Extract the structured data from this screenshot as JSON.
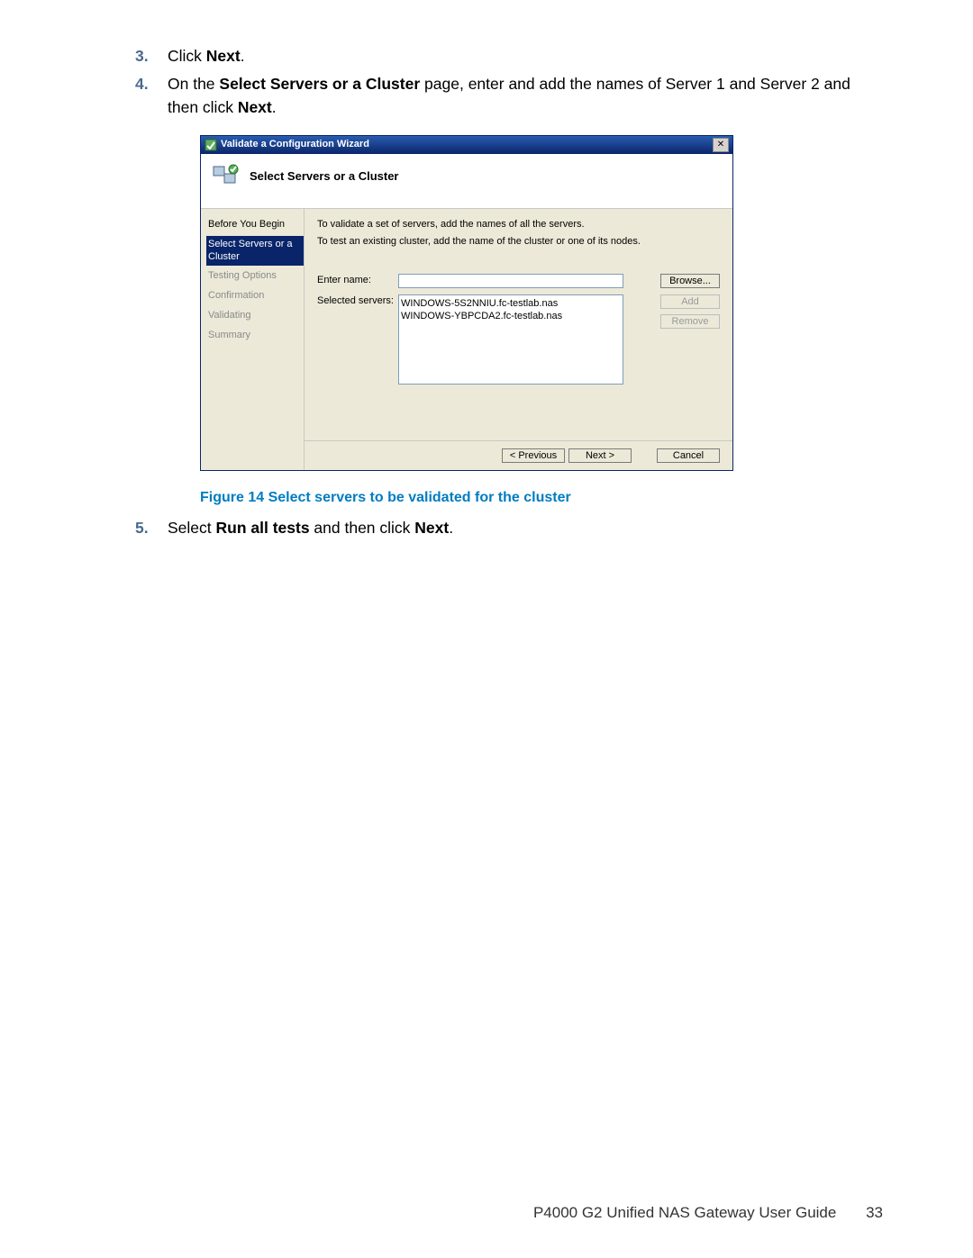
{
  "steps": {
    "s3": {
      "num": "3.",
      "pre": "Click ",
      "bold": "Next",
      "post": "."
    },
    "s4": {
      "num": "4.",
      "pre": "On the ",
      "bold1": "Select Servers or a Cluster",
      "mid": " page, enter and add the names of Server 1 and Server 2 and then click ",
      "bold2": "Next",
      "post": "."
    },
    "s5": {
      "num": "5.",
      "pre": "Select ",
      "bold1": "Run all tests",
      "mid": " and then click ",
      "bold2": "Next",
      "post": "."
    }
  },
  "wizard": {
    "title": "Validate a Configuration Wizard",
    "header_title": "Select Servers or a Cluster",
    "close_glyph": "✕",
    "nav": [
      {
        "label": "Before You Begin",
        "state": "normal"
      },
      {
        "label": "Select Servers or a Cluster",
        "state": "selected"
      },
      {
        "label": "Testing Options",
        "state": "disabled"
      },
      {
        "label": "Confirmation",
        "state": "disabled"
      },
      {
        "label": "Validating",
        "state": "disabled"
      },
      {
        "label": "Summary",
        "state": "disabled"
      }
    ],
    "instr1": "To validate a set of servers, add the names of all the servers.",
    "instr2": "To test an existing cluster, add the name of the cluster or one of its nodes.",
    "enter_name_label": "Enter name:",
    "enter_name_value": "",
    "selected_servers_label": "Selected servers:",
    "selected_servers": [
      "WINDOWS-5S2NNIU.fc-testlab.nas",
      "WINDOWS-YBPCDA2.fc-testlab.nas"
    ],
    "btn_browse": "Browse...",
    "btn_add": "Add",
    "btn_remove": "Remove",
    "btn_previous": "< Previous",
    "btn_next": "Next >",
    "btn_cancel": "Cancel"
  },
  "figure_caption": "Figure 14 Select servers to be validated for the cluster",
  "footer": {
    "title": "P4000 G2 Unified NAS Gateway User Guide",
    "page": "33"
  }
}
